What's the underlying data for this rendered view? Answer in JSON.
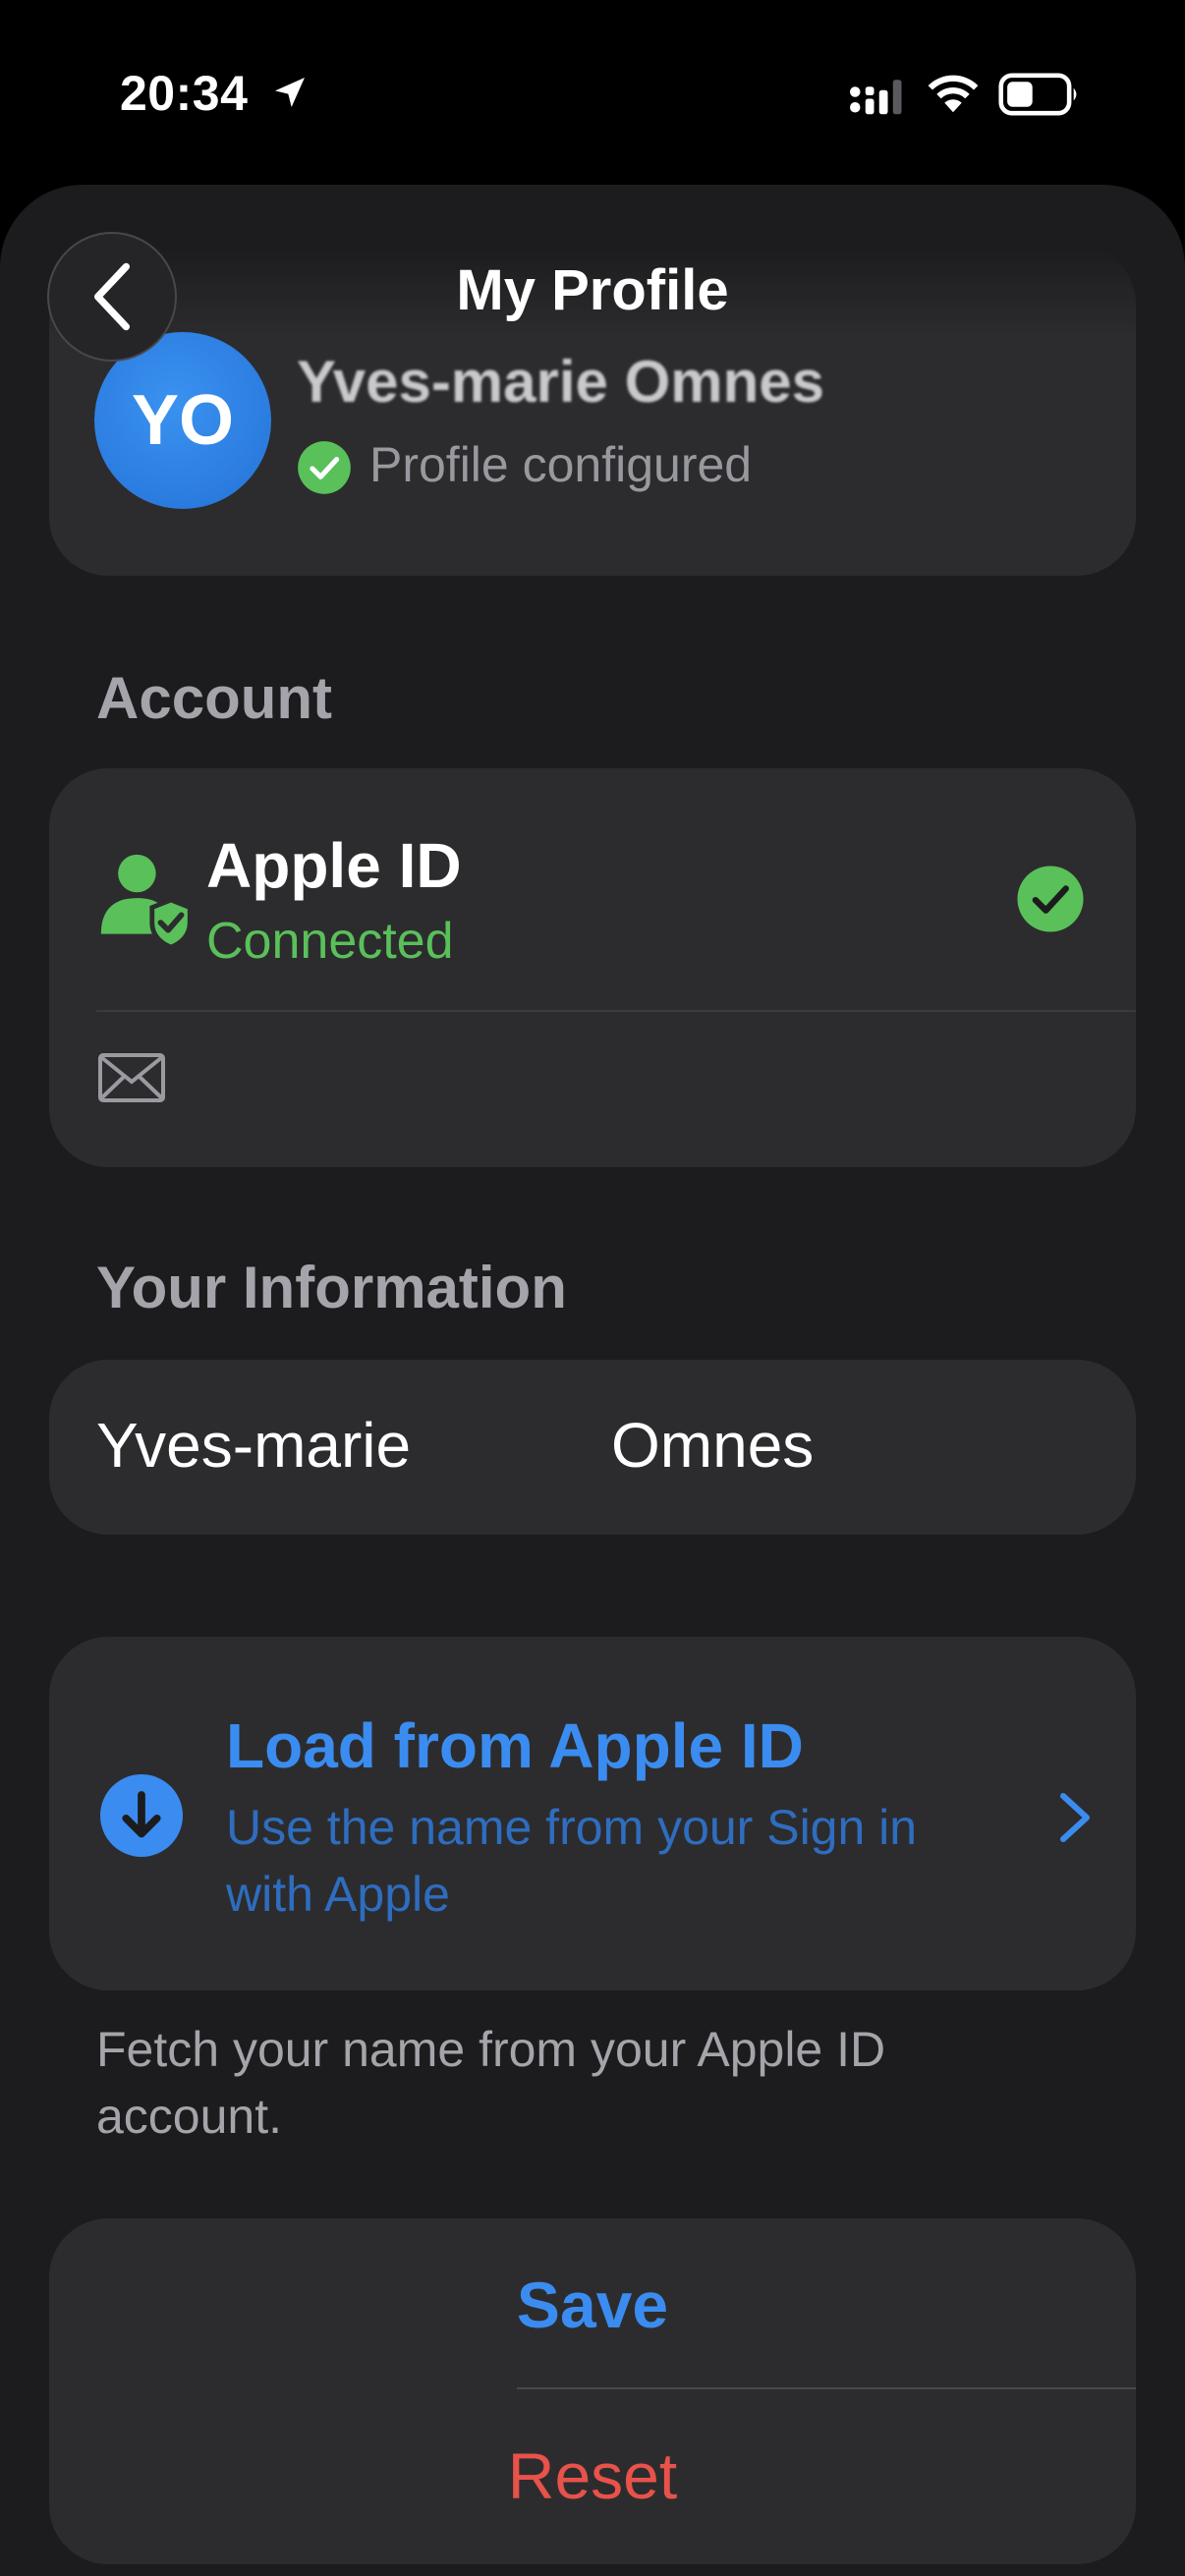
{
  "status_bar": {
    "time": "20:34",
    "icons": [
      "location-arrow-icon",
      "cellular-signal-icon",
      "wifi-icon",
      "battery-icon"
    ]
  },
  "nav": {
    "title": "My Profile",
    "back_icon": "chevron-left-icon"
  },
  "profile": {
    "initials": "YO",
    "name": "Yves-marie Omnes",
    "status": "Profile configured",
    "status_icon": "checkmark-circle-icon"
  },
  "account": {
    "section_label": "Account",
    "apple_id_title": "Apple ID",
    "apple_id_status": "Connected",
    "email": ""
  },
  "info": {
    "section_label": "Your Information",
    "first_name": "Yves-marie",
    "last_name": "Omnes"
  },
  "load": {
    "title": "Load from Apple ID",
    "subtitle": "Use the name from your Sign in with Apple",
    "footer": "Fetch your name from your Apple ID account."
  },
  "actions": {
    "save_label": "Save",
    "reset_label": "Reset"
  },
  "colors": {
    "accent": "#3b8cf0",
    "success": "#5ac05a",
    "destructive": "#e8524a",
    "card": "#2c2c2e",
    "sheet": "#1c1c1e"
  }
}
